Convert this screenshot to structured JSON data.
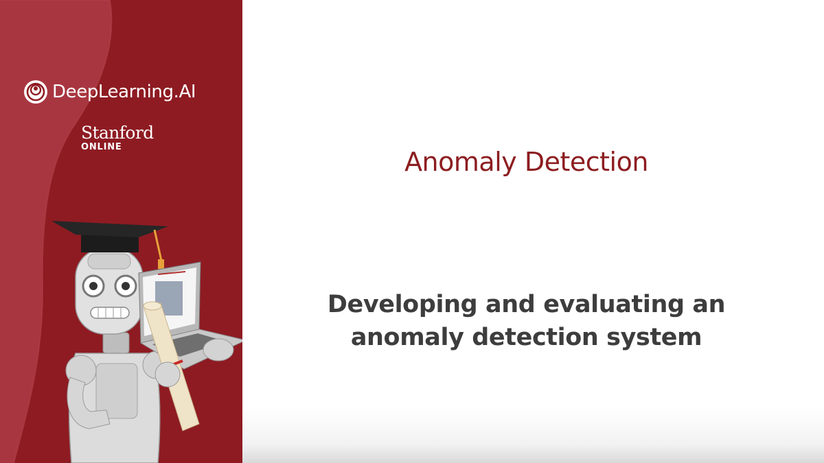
{
  "brand": {
    "logo_icon": "deeplearning-ai-logo",
    "name": "DeepLearning.AI",
    "partner_name": "Stanford",
    "partner_sub": "ONLINE"
  },
  "slide": {
    "title": "Anomaly Detection",
    "subtitle_line1": "Developing and evaluating an",
    "subtitle_line2": "anomaly detection system"
  },
  "colors": {
    "sidebar": "#8e1b22",
    "sidebar_wave": "#a83640",
    "title": "#8c1d20",
    "subtitle": "#3d3d3d"
  }
}
